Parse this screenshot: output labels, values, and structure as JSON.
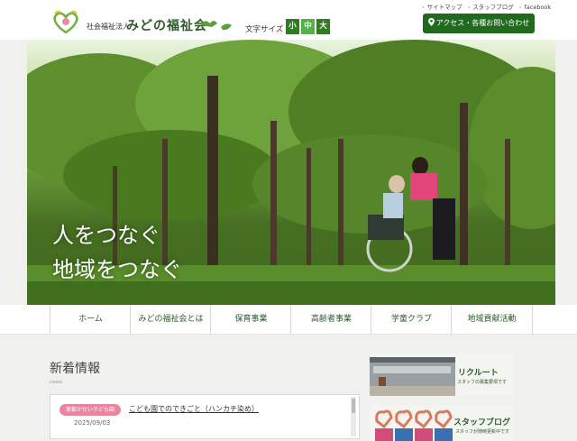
{
  "header": {
    "corp_type": "社会福祉法人",
    "corp_name": "みどの福祉会",
    "font_size_label": "文字サイズ",
    "font_sizes": [
      "小",
      "中",
      "大"
    ],
    "utility_links": [
      "サイトマップ",
      "スタッフブログ",
      "facebook"
    ],
    "contact_button": "アクセス・各種お問い合わせ"
  },
  "hero": {
    "line1": "人をつなぐ",
    "line2": "地域をつなぐ"
  },
  "nav": {
    "items": [
      "ホーム",
      "みどの福祉会とは",
      "保育事業",
      "高齢者事業",
      "学童クラブ",
      "地域貢献活動"
    ]
  },
  "news": {
    "title": "新着情報",
    "subtitle": "news",
    "items": [
      {
        "tag": "恵都かせい子ども園",
        "title": "こども園でのできごと（ハンカチ染め）",
        "date": "2025/09/03"
      }
    ]
  },
  "banners": {
    "recruit_title": "リクルート",
    "recruit_sub": "スタッフの募集要項です",
    "blog_title": "スタッフブログ",
    "blog_sub": "スタッフが随時更新中です"
  },
  "colors": {
    "brand_green": "#2e7d1f",
    "brand_dark_green": "#1f6a1f",
    "tag_pink": "#e985a0"
  }
}
